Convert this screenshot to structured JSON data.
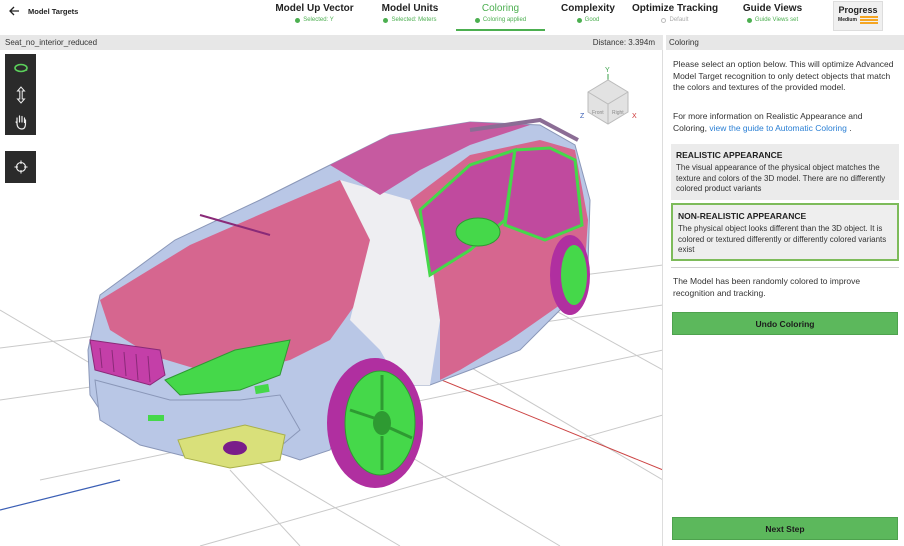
{
  "app": {
    "back_label": "Model Targets"
  },
  "steps": [
    {
      "title": "Model Up Vector",
      "status": "Selected: Y",
      "state": "done"
    },
    {
      "title": "Model Units",
      "status": "Selected: Meters",
      "state": "done"
    },
    {
      "title": "Coloring",
      "status": "Coloring applied",
      "state": "active"
    },
    {
      "title": "Complexity",
      "status": "Good",
      "state": "done"
    },
    {
      "title": "Optimize Tracking",
      "status": "Default",
      "state": "pending"
    },
    {
      "title": "Guide Views",
      "status": "Guide Views set",
      "state": "done"
    }
  ],
  "progress": {
    "title": "Progress",
    "level": "Medium",
    "color": "#f5a623"
  },
  "viewport": {
    "model_name": "Seat_no_interior_reduced",
    "distance": "Distance:  3.394m",
    "tools": [
      "orbit-icon",
      "pan-vertical-icon",
      "hand-icon"
    ],
    "tools2": [
      "focus-target-icon"
    ],
    "gizmo": {
      "y": "Y",
      "x": "X",
      "z": "Z",
      "front": "Front",
      "right": "Right"
    }
  },
  "panel": {
    "header": "Coloring",
    "intro": "Please select an option below. This will optimize Advanced Model Target recognition to only detect objects that match the colors and textures of the provided model.",
    "more_info_prefix": "For more information on Realistic Appearance and Coloring, ",
    "more_info_link": "view the guide to Automatic Coloring",
    "more_info_suffix": " .",
    "options": [
      {
        "title": "REALISTIC APPEARANCE",
        "body": "The visual appearance of the physical object matches the texture and colors of the 3D model. There are no differently colored product variants",
        "selected": false
      },
      {
        "title": "NON-REALISTIC APPEARANCE",
        "body": "The physical object looks different than the 3D object. It is colored or textured differently or differently colored variants exist",
        "selected": true
      }
    ],
    "note": "The Model has been randomly colored to improve recognition and tracking.",
    "undo_button": "Undo Coloring",
    "next_button": "Next Step"
  },
  "colors": {
    "accent_green": "#5cb85c",
    "status_green": "#4caf50",
    "link_blue": "#2a7fd4",
    "car_pink": "#d6668f",
    "car_magenta": "#c43fa8",
    "car_lightblue": "#b9c7e6",
    "car_green": "#45d84a"
  }
}
